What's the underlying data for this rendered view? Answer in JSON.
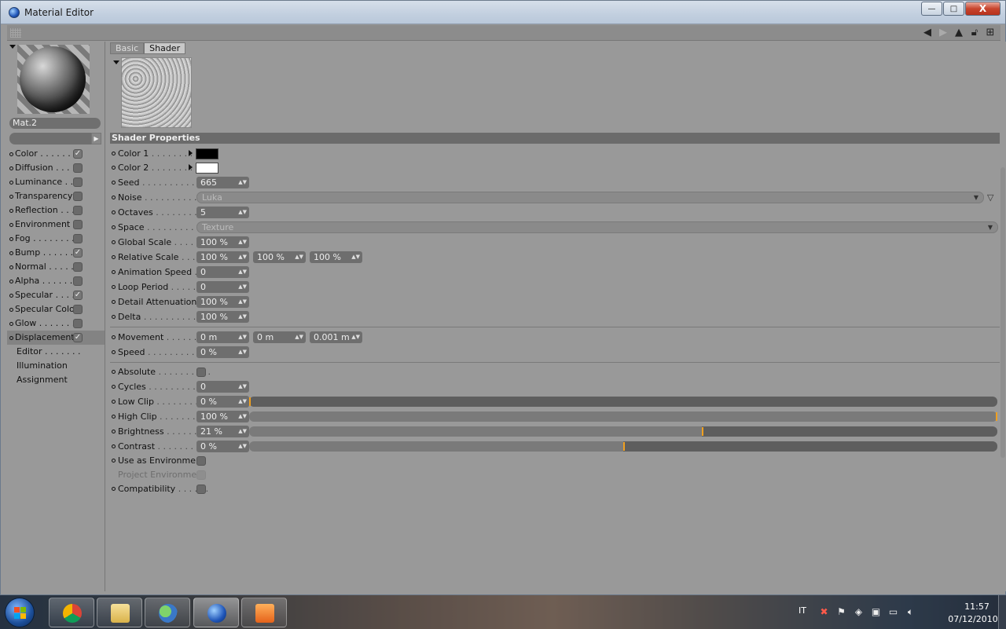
{
  "window": {
    "title": "Material Editor"
  },
  "window_buttons": {
    "minimize": "—",
    "maximize": "□",
    "close": "X"
  },
  "toolbar_icons": [
    "arrow-left-icon",
    "arrow-right-icon",
    "arrow-up-icon",
    "lock-icon",
    "new-window-icon"
  ],
  "material": {
    "name": "Mat.2"
  },
  "channels": [
    {
      "label": "Color",
      "dots": " . . . . . . . ",
      "checked": true
    },
    {
      "label": "Diffusion",
      "dots": " . . . . ",
      "checked": false
    },
    {
      "label": "Luminance",
      "dots": " . . . ",
      "checked": false
    },
    {
      "label": "Transparency",
      "dots": "",
      "checked": false
    },
    {
      "label": "Reflection",
      "dots": " . . . .",
      "checked": false
    },
    {
      "label": "Environment",
      "dots": "",
      "checked": false
    },
    {
      "label": "Fog",
      "dots": " . . . . . . . . .",
      "checked": false
    },
    {
      "label": "Bump",
      "dots": " . . . . . . .",
      "checked": true
    },
    {
      "label": "Normal",
      "dots": " . . . . . .",
      "checked": false
    },
    {
      "label": "Alpha",
      "dots": " . . . . . . .",
      "checked": false
    },
    {
      "label": "Specular",
      "dots": " . . . . .",
      "checked": true
    },
    {
      "label": "Specular Color",
      "dots": "",
      "checked": false
    },
    {
      "label": "Glow",
      "dots": " . . . . . . . .",
      "checked": false
    },
    {
      "label": "Displacement",
      "dots": "",
      "checked": true,
      "selected": true
    }
  ],
  "sub_items": [
    "Editor . . . . . . .",
    "Illumination",
    "Assignment"
  ],
  "tabs": {
    "basic": "Basic",
    "shader": "Shader"
  },
  "section": {
    "title": "Shader Properties"
  },
  "props": {
    "color1": {
      "label": "Color 1",
      "dots": " . . . . . . . . ."
    },
    "color2": {
      "label": "Color 2",
      "dots": " . . . . . . . . ."
    },
    "seed": {
      "label": "Seed",
      "dots": " . . . . . . . . . . . .",
      "value": "665"
    },
    "noise": {
      "label": "Noise",
      "dots": " . . . . . . . . . . . .",
      "value": "Luka"
    },
    "octaves": {
      "label": "Octaves",
      "dots": " . . . . . . . . . .",
      "value": "5"
    },
    "space": {
      "label": "Space",
      "dots": " . . . . . . . . . . . .",
      "value": "Texture"
    },
    "global_scale": {
      "label": "Global Scale",
      "dots": " . . . . . .",
      "value": "100 %"
    },
    "relative_scale": {
      "label": "Relative Scale",
      "dots": " . . . .",
      "v1": "100 %",
      "v2": "100 %",
      "v3": "100 %"
    },
    "animation_speed": {
      "label": "Animation Speed",
      "dots": " . .",
      "value": "0"
    },
    "loop_period": {
      "label": "Loop Period",
      "dots": " . . . . . .",
      "value": "0"
    },
    "detail_attenuation": {
      "label": "Detail Attenuation",
      "dots": " . .",
      "value": "100 %"
    },
    "delta": {
      "label": "Delta",
      "dots": " . . . . . . . . . . . .",
      "value": "100 %"
    },
    "movement": {
      "label": "Movement",
      "dots": " . . . . . . . .",
      "v1": "0 m",
      "v2": "0 m",
      "v3": "0.001 m"
    },
    "speed": {
      "label": "Speed",
      "dots": " . . . . . . . . . . . .",
      "value": "0 %"
    },
    "absolute": {
      "label": "Absolute",
      "dots": " . . . . . . . . . ."
    },
    "cycles": {
      "label": "Cycles",
      "dots": " . . . . . . . . . . . .",
      "value": "0"
    },
    "low_clip": {
      "label": "Low Clip",
      "dots": " . . . . . . . . .",
      "value": "0 %",
      "level": 0.0
    },
    "high_clip": {
      "label": "High Clip",
      "dots": " . . . . . . . . .",
      "value": "100 %",
      "level": 1.0
    },
    "brightness": {
      "label": "Brightness",
      "dots": " . . . . . . .",
      "value": "21 %",
      "level": 0.605
    },
    "contrast": {
      "label": "Contrast",
      "dots": " . . . . . . . .",
      "value": "0 %",
      "level": 0.5
    },
    "use_as_env": {
      "label": "Use as Environment"
    },
    "project_env": {
      "label": "Project Environment"
    },
    "compatibility": {
      "label": "Compatibility",
      "dots": " . . . . . ."
    }
  },
  "colors": {
    "color1": "#000000",
    "color2": "#ffffff",
    "slider_marker": "#f0a020"
  },
  "taskbar": {
    "apps": [
      "start-orb-icon",
      "chrome-icon",
      "explorer-icon",
      "messenger-icon",
      "cinema4d-icon",
      "media-player-icon"
    ],
    "language": "IT",
    "time": "11:57",
    "date": "07/12/2010"
  }
}
